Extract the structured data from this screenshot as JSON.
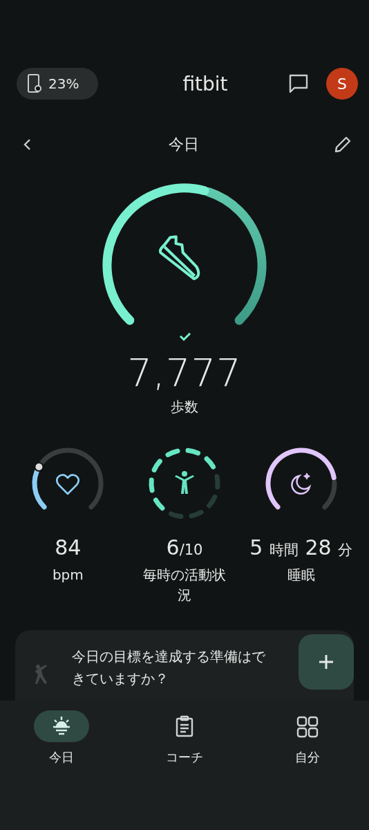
{
  "top_bar": {
    "battery": "23%",
    "logo": "fitbit",
    "avatar": "S"
  },
  "header": {
    "title": "今日"
  },
  "steps": {
    "goal_met": true,
    "value": "7,777",
    "label": "歩数"
  },
  "metrics": [
    {
      "kind": "heart",
      "parts": [
        {
          "kind": "number",
          "text": "84"
        }
      ],
      "label": "bpm"
    },
    {
      "kind": "activity",
      "segments": [
        {
          "done": true
        },
        {
          "done": true
        },
        {
          "done": false
        },
        {
          "done": false
        },
        {
          "done": false
        },
        {
          "done": false
        },
        {
          "done": true
        },
        {
          "done": true
        },
        {
          "done": true
        },
        {
          "done": true
        }
      ],
      "parts": [
        {
          "kind": "number",
          "text": "6"
        },
        {
          "kind": "unit",
          "text": "/10"
        }
      ],
      "label": "毎時の活動状況"
    },
    {
      "kind": "sleep",
      "parts": [
        {
          "kind": "number",
          "text": "5"
        },
        {
          "kind": "unit",
          "text": "時間"
        },
        {
          "kind": "number",
          "text": "28"
        },
        {
          "kind": "unit",
          "text": "分"
        }
      ],
      "label": "睡眠"
    }
  ],
  "goal_card": {
    "text": "今日の目標を達成する準備はできていますか？"
  },
  "nav": [
    {
      "label": "今日",
      "selected": true
    },
    {
      "label": "コーチ",
      "selected": false
    },
    {
      "label": "自分",
      "selected": false
    }
  ]
}
